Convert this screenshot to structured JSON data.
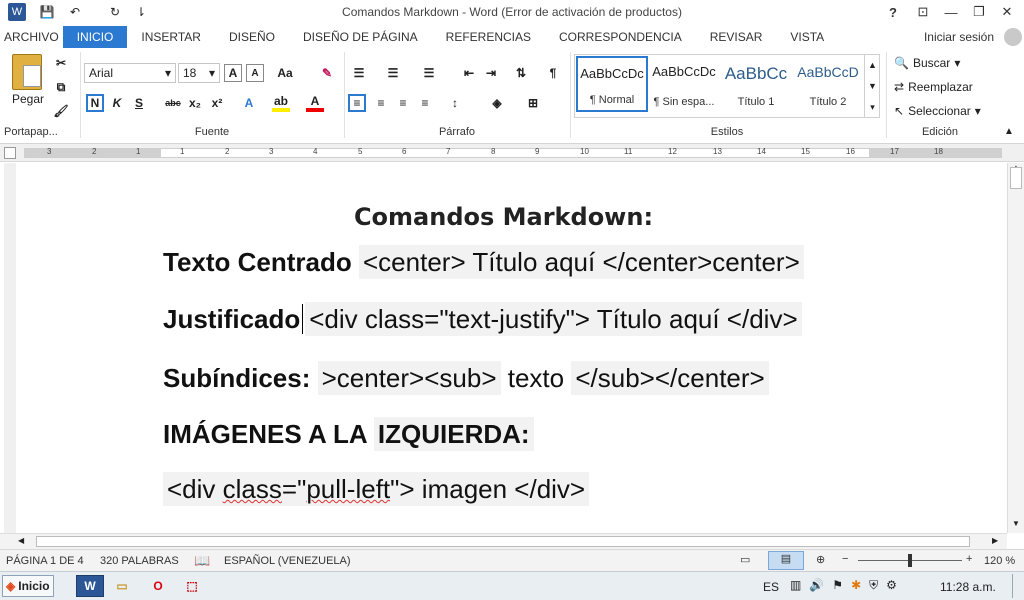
{
  "window": {
    "title": "Comandos Markdown - Word (Error de activación de productos)",
    "help": "?",
    "ribbon_options": "⊡",
    "minimize": "—",
    "restore": "❐",
    "close": "✕"
  },
  "quick_access": {
    "word_icon": "W",
    "save": "💾",
    "undo": "↶",
    "redo": "↻",
    "customize": "⇂"
  },
  "tabs": [
    "ARCHIVO",
    "INICIO",
    "INSERTAR",
    "DISEÑO",
    "DISEÑO DE PÁGINA",
    "REFERENCIAS",
    "CORRESPONDENCIA",
    "REVISAR",
    "VISTA"
  ],
  "active_tab": "INICIO",
  "signin": "Iniciar sesión",
  "clipboard": {
    "paste_label": "Pegar",
    "group_label": "Portapap..."
  },
  "font": {
    "name": "Arial",
    "size": "18",
    "group_label": "Fuente",
    "bold": "N",
    "italic": "K",
    "underline": "S",
    "strike": "abc",
    "sub": "x₂",
    "sup": "x²"
  },
  "paragraph": {
    "group_label": "Párrafo"
  },
  "styles": {
    "group_label": "Estilos",
    "items": [
      {
        "sample": "AaBbCcDc",
        "name": "¶ Normal"
      },
      {
        "sample": "AaBbCcDc",
        "name": "¶ Sin espa..."
      },
      {
        "sample": "AaBbCc",
        "name": "Título 1"
      },
      {
        "sample": "AaBbCcD",
        "name": "Título 2"
      }
    ]
  },
  "editing": {
    "group_label": "Edición",
    "find": "Buscar",
    "replace": "Reemplazar",
    "select": "Seleccionar"
  },
  "ruler_numbers": [
    "3",
    "2",
    "1",
    "1",
    "2",
    "3",
    "4",
    "5",
    "6",
    "7",
    "8",
    "9",
    "10",
    "11",
    "12",
    "13",
    "14",
    "15",
    "16",
    "17",
    "18"
  ],
  "document": {
    "heading": "Comandos Markdown:",
    "line1_label": "Texto Centrado",
    "line1_code": "<center> Título aquí </center>center>",
    "line2_label": "Justificado",
    "line2_code": "<div class=\"text-justify\"> Título aquí </div>",
    "line3_label": "Subíndices:",
    "line3_code_a": ">center><sub>",
    "line3_text": "texto",
    "line3_code_b": "</sub></center>",
    "line4_a": "IMÁGENES A LA ",
    "line4_b": "IZQUIERDA:",
    "line5_a": "<div ",
    "line5_b": "class",
    "line5_c": "=\"",
    "line5_d": "pull-left",
    "line5_e": "\"> imagen </div>"
  },
  "status": {
    "page": "PÁGINA 1 DE 4",
    "words": "320 PALABRAS",
    "language": "ESPAÑOL (VENEZUELA)",
    "zoom": "120 %"
  },
  "taskbar": {
    "start": "Inicio",
    "lang": "ES",
    "time": "11:28 a.m."
  }
}
